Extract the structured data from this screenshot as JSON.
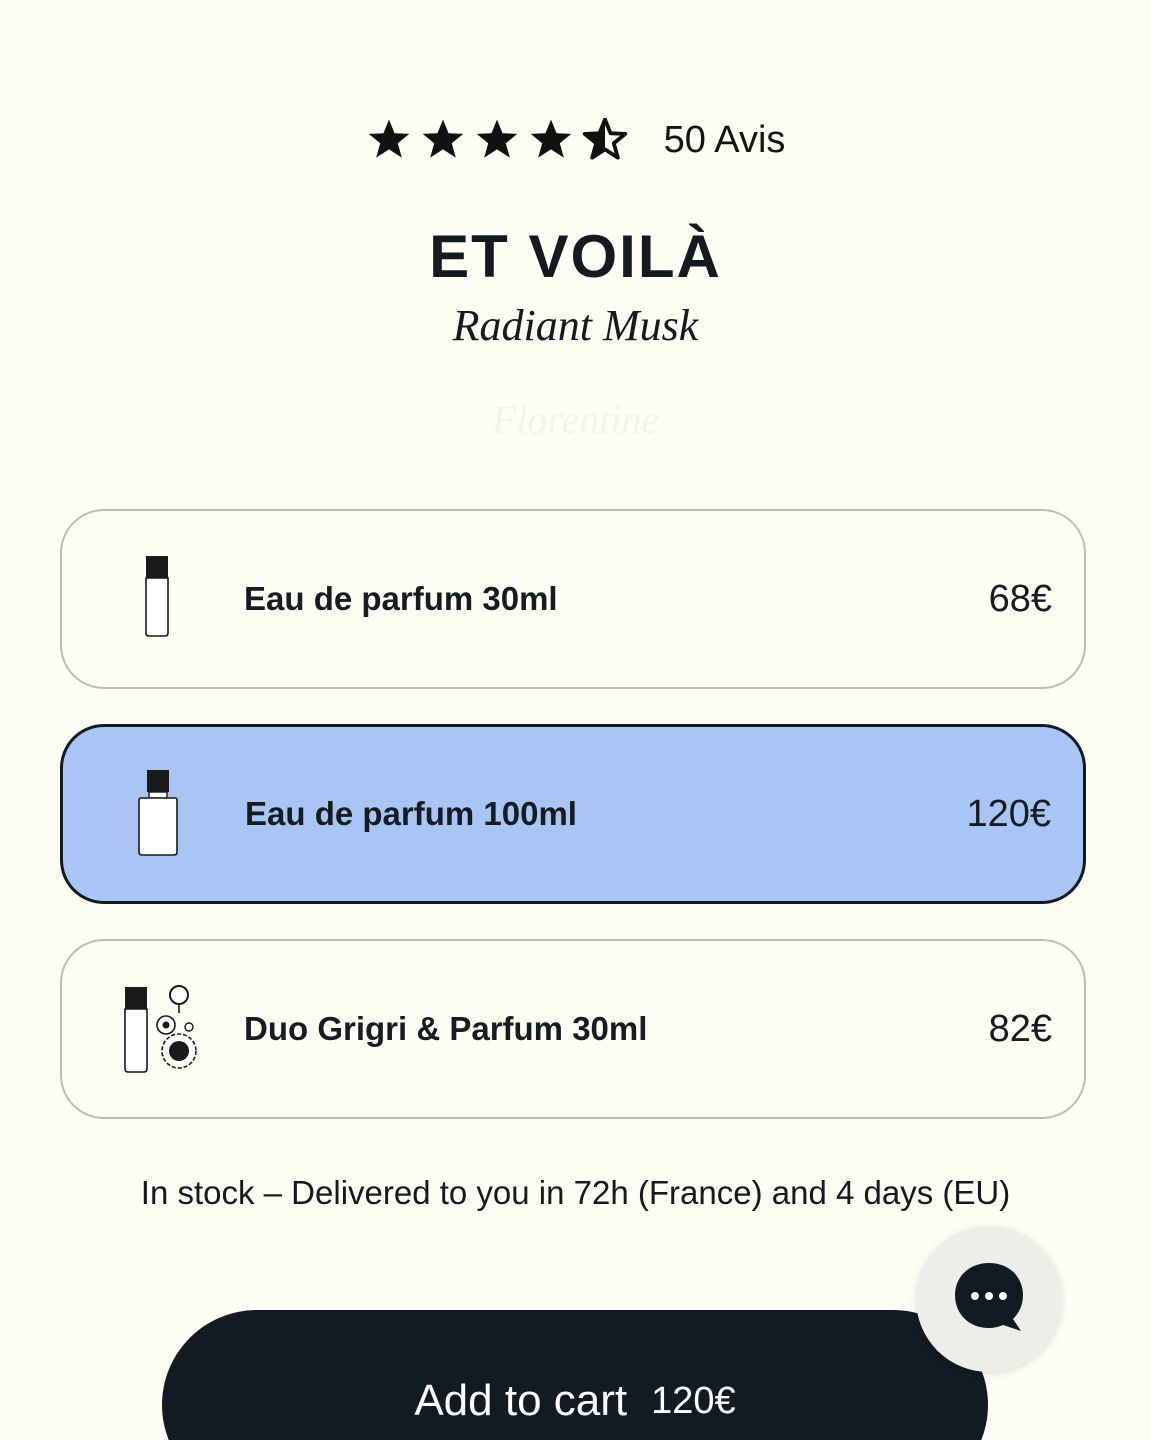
{
  "rating": {
    "value": 4.5,
    "max": 5,
    "reviews_label": "50 Avis"
  },
  "product": {
    "title": "ET VOILÀ",
    "subtitle": "Radiant Musk",
    "faded_line": "Florentine"
  },
  "options": [
    {
      "label": "Eau de parfum 30ml",
      "price": "68€",
      "icon": "bottle-30ml-icon",
      "selected": false
    },
    {
      "label": "Eau de parfum 100ml",
      "price": "120€",
      "icon": "bottle-100ml-icon",
      "selected": true
    },
    {
      "label": "Duo Grigri & Parfum 30ml",
      "price": "82€",
      "icon": "bottle-keychain-icon",
      "selected": false
    }
  ],
  "stock_text": "In stock – Delivered to you in 72h (France) and 4 days (EU)",
  "cart": {
    "label": "Add to cart",
    "price": "120€"
  },
  "chat": {
    "icon": "chat-bubble-icon"
  },
  "colors": {
    "background": "#fdfdf3",
    "selected_option": "#a9c5f6",
    "dark": "#121b22",
    "border": "#bdbdb6"
  }
}
